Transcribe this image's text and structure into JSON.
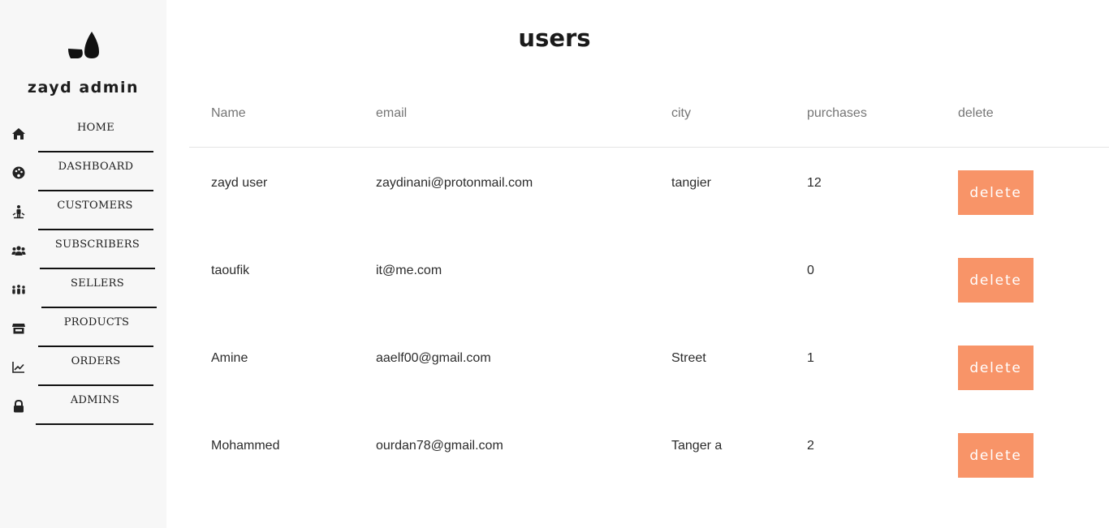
{
  "brand": {
    "name": "zayd admin",
    "logo_icon": "leaf-logo-icon"
  },
  "nav": [
    {
      "label": "HOME",
      "icon": "home-icon"
    },
    {
      "label": "DASHBOARD",
      "icon": "palette-icon"
    },
    {
      "label": "CUSTOMERS",
      "icon": "street-view-icon"
    },
    {
      "label": "SUBSCRIBERS",
      "icon": "users-icon"
    },
    {
      "label": "SELLERS",
      "icon": "people-group-icon"
    },
    {
      "label": "PRODUCTS",
      "icon": "store-icon"
    },
    {
      "label": "ORDERS",
      "icon": "line-chart-icon"
    },
    {
      "label": "ADMINS",
      "icon": "lock-icon"
    }
  ],
  "page": {
    "title": "users"
  },
  "table": {
    "columns": [
      "Name",
      "email",
      "city",
      "purchases",
      "delete"
    ],
    "rows": [
      {
        "name": "zayd user",
        "email": "zaydinani@protonmail.com",
        "city": "tangier",
        "purchases": "12",
        "action": "delete"
      },
      {
        "name": "taoufik",
        "email": "it@me.com",
        "city": "",
        "purchases": "0",
        "action": "delete"
      },
      {
        "name": "Amine",
        "email": "aaelf00@gmail.com",
        "city": "Street",
        "purchases": "1",
        "action": "delete"
      },
      {
        "name": "Mohammed",
        "email": "ourdan78@gmail.com",
        "city": "Tanger a",
        "purchases": "2",
        "action": "delete"
      }
    ]
  },
  "colors": {
    "sidebar_bg": "#f7f7f7",
    "delete_button": "#f89468",
    "header_text": "#757575"
  }
}
